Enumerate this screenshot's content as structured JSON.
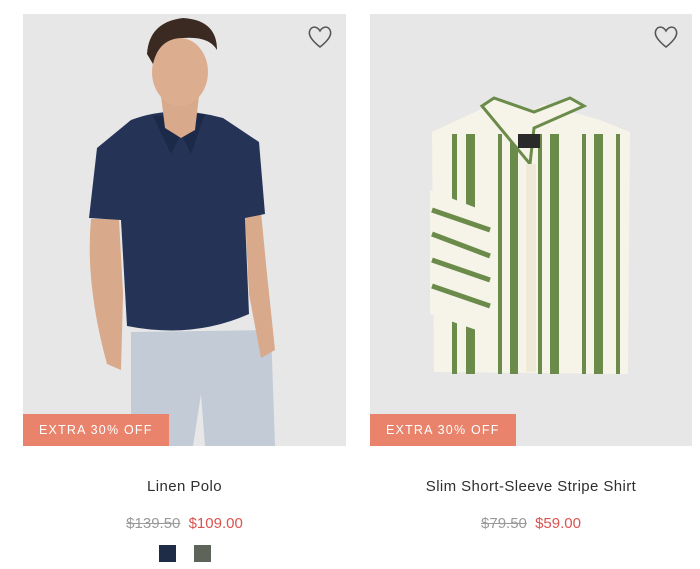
{
  "products": [
    {
      "badge": "EXTRA 30% OFF",
      "name": "Linen Polo",
      "original_price": "$139.50",
      "sale_price": "$109.00",
      "swatches": [
        {
          "color": "#1f2c47",
          "name": "navy"
        },
        {
          "color": "#5e6459",
          "name": "olive-gray"
        }
      ]
    },
    {
      "badge": "EXTRA 30% OFF",
      "name": "Slim Short-Sleeve Stripe Shirt",
      "original_price": "$79.50",
      "sale_price": "$59.00"
    }
  ],
  "colors": {
    "badge_bg": "#e9836b",
    "sale_price": "#d9534f",
    "original_price": "#9a9a9a",
    "image_bg": "#e7e7e7"
  }
}
